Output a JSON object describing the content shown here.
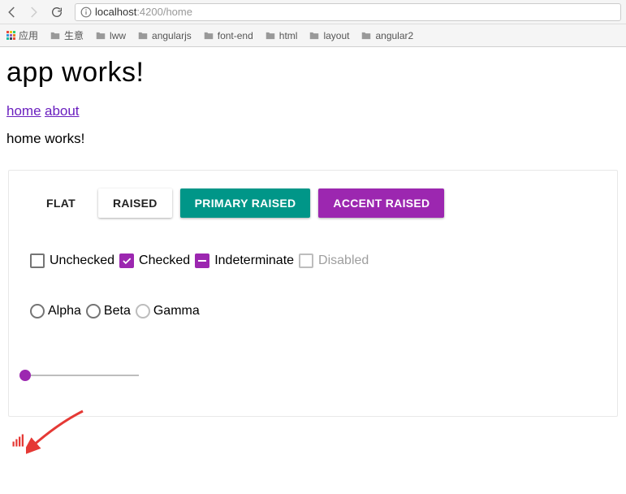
{
  "browser": {
    "url_host": "localhost",
    "url_rest": ":4200/home"
  },
  "bookmarks": {
    "apps_label": "应用",
    "folders": [
      "生意",
      "lww",
      "angularjs",
      "font-end",
      "html",
      "layout",
      "angular2"
    ]
  },
  "page": {
    "title": "app works!",
    "nav": {
      "home": "home",
      "about": "about"
    },
    "route_text": "home works!"
  },
  "buttons": {
    "flat": "FLAT",
    "raised": "RAISED",
    "primary": "PRIMARY RAISED",
    "accent": "ACCENT RAISED"
  },
  "checkboxes": {
    "unchecked": "Unchecked",
    "checked": "Checked",
    "indeterminate": "Indeterminate",
    "disabled": "Disabled"
  },
  "radios": {
    "alpha": "Alpha",
    "beta": "Beta",
    "gamma": "Gamma"
  },
  "colors": {
    "primary": "#009688",
    "accent": "#9c27b0",
    "link": "#6a1fbf",
    "chart_icon": "#e53935"
  }
}
